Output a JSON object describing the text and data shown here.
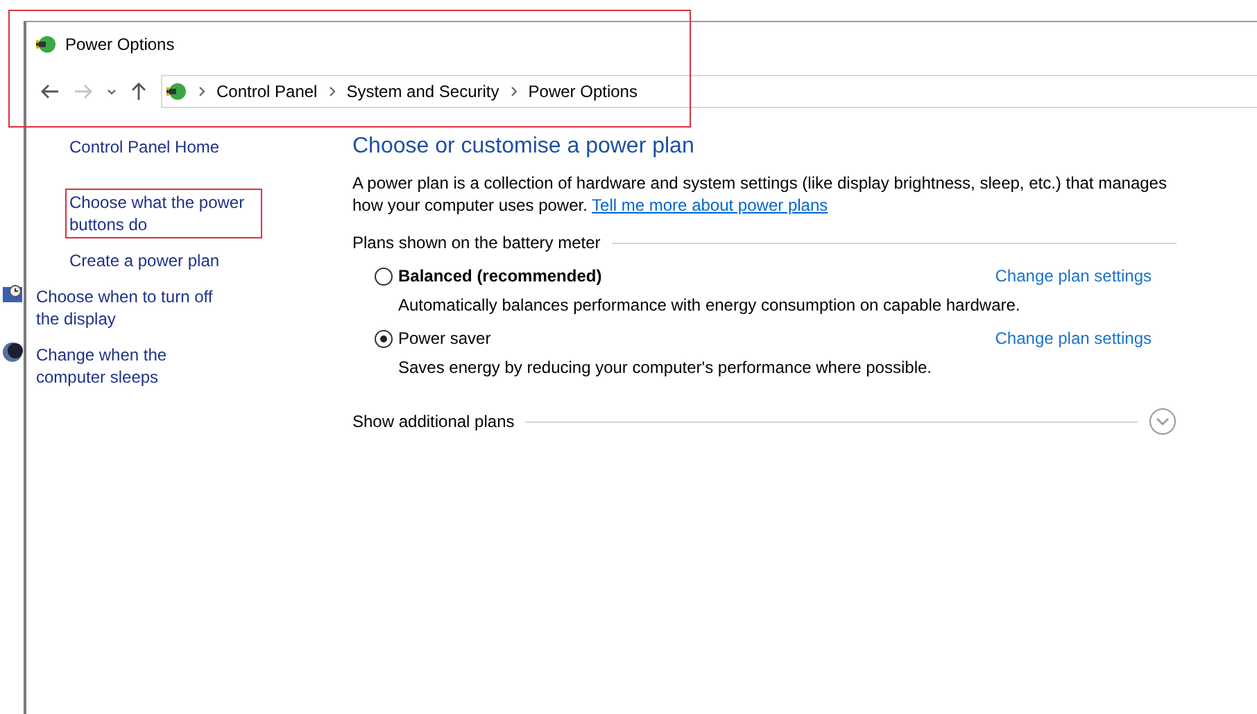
{
  "window": {
    "title": "Power Options",
    "highlighted": true
  },
  "breadcrumb": [
    "Control Panel",
    "System and Security",
    "Power Options"
  ],
  "sidebar": {
    "home": "Control Panel Home",
    "items": [
      {
        "label": "Choose what the power buttons do",
        "kind": "plain",
        "highlighted": true
      },
      {
        "label": "Create a power plan",
        "kind": "plain",
        "highlighted": false
      },
      {
        "label": "Choose when to turn off the display",
        "kind": "display",
        "highlighted": false
      },
      {
        "label": "Change when the computer sleeps",
        "kind": "sleep",
        "highlighted": false
      }
    ]
  },
  "main": {
    "heading": "Choose or customise a power plan",
    "intro": "A power plan is a collection of hardware and system settings (like display brightness, sleep, etc.) that manages how your computer uses power.",
    "intro_link": "Tell me more about power plans",
    "group_label": "Plans shown on the battery meter",
    "plans": [
      {
        "name": "Balanced (recommended)",
        "selected": false,
        "description": "Automatically balances performance with energy consumption on capable hardware.",
        "link": "Change plan settings"
      },
      {
        "name": "Power saver",
        "selected": true,
        "description": "Saves energy by reducing your computer's performance where possible.",
        "link": "Change plan settings"
      }
    ],
    "more": "Show additional plans"
  }
}
